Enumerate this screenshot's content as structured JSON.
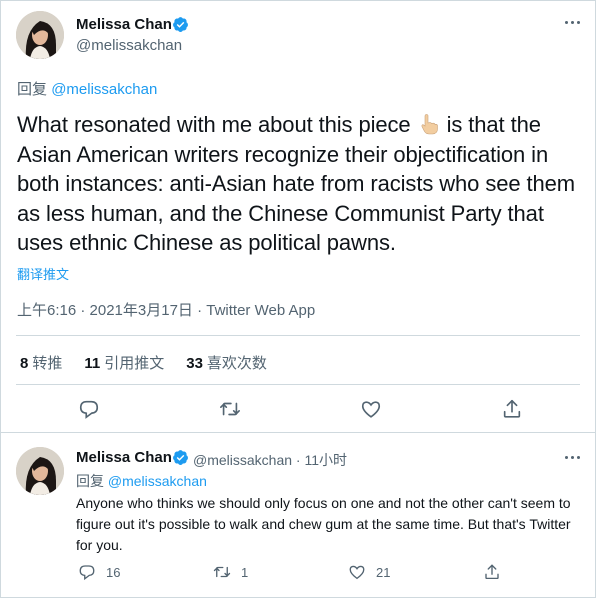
{
  "main_tweet": {
    "author_name": "Melissa Chan",
    "author_handle": "@melissakchan",
    "reply_prefix": "回复",
    "reply_to": "@melissakchan",
    "text_before_emoji": "What resonated with me about this piece ",
    "text_after_emoji": " is that the Asian American writers recognize their objectification in both instances: anti-Asian hate from racists who see them as less human, and the Chinese Communist Party that uses ethnic Chinese as political pawns.",
    "emoji": "pointing-hand-emoji",
    "translate_label": "翻译推文",
    "timestamp": "上午6:16 · 2021年3月17日 · Twitter Web App",
    "stats": [
      {
        "count": "8",
        "label": "转推"
      },
      {
        "count": "11",
        "label": "引用推文"
      },
      {
        "count": "33",
        "label": "喜欢次数"
      }
    ]
  },
  "reply_tweet": {
    "author_name": "Melissa Chan",
    "meta": "@melissakchan · 11小时",
    "reply_prefix": "回复",
    "reply_to": "@melissakchan",
    "text": "Anyone who thinks we should only focus on one and not the other can't seem to figure out it's possible to walk and chew gum at the same time. But that's Twitter for you.",
    "reply_count": "16",
    "retweet_count": "1",
    "like_count": "21"
  },
  "colors": {
    "text": "#0f1419",
    "secondary": "#536471",
    "accent": "#1d9bf0",
    "divider": "#cfd9de"
  },
  "icons": [
    "verified-badge-icon",
    "more-options-icon",
    "reply-icon",
    "retweet-icon",
    "like-icon",
    "share-icon"
  ]
}
